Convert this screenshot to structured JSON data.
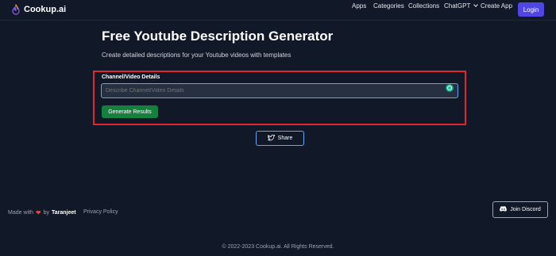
{
  "app": {
    "name": "Cookup.ai"
  },
  "nav": {
    "items": [
      "Apps",
      "Categories",
      "Collections",
      "ChatGPT",
      "Create App"
    ],
    "login_label": "Login"
  },
  "main": {
    "title": "Free Youtube Description Generator",
    "subtitle": "Create detailed descriptions for your Youtube videos with templates",
    "field_label": "Channel/Video Details",
    "field_placeholder": "Describe Channel/Video Details",
    "field_value": "",
    "generate_label": "Generate Results",
    "share_label": "Share"
  },
  "footer": {
    "made_with_prefix": "Made with",
    "made_with_by": "by",
    "author": "Taranjeet",
    "privacy": "Privacy Policy",
    "discord_label": "Join Discord",
    "copyright": "© 2022-2023 Cookup.ai. All Rights Reserved."
  },
  "colors": {
    "background": "#111827",
    "login_button": "#4f46e5",
    "generate_button": "#15803d",
    "highlight_border": "#e0262e",
    "input_focus_border": "#60a5fa",
    "heart": "#ef4444"
  },
  "icons": {
    "logo": "flame-icon",
    "chatgpt_dropdown": "chevron-down-icon",
    "grammarly": "grammarly-icon",
    "share": "twitter-icon",
    "heart": "heart-icon",
    "discord": "discord-icon"
  }
}
